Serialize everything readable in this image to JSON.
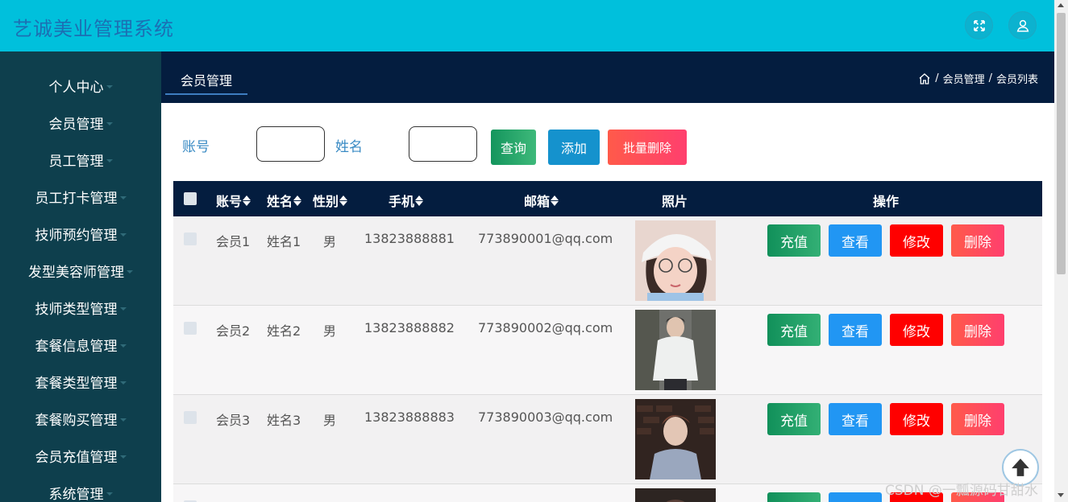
{
  "header": {
    "title": "艺诚美业管理系统"
  },
  "sidebar": {
    "items": [
      {
        "label": "个人中心"
      },
      {
        "label": "会员管理"
      },
      {
        "label": "员工管理"
      },
      {
        "label": "员工打卡管理"
      },
      {
        "label": "技师预约管理"
      },
      {
        "label": "发型美容师管理"
      },
      {
        "label": "技师类型管理"
      },
      {
        "label": "套餐信息管理"
      },
      {
        "label": "套餐类型管理"
      },
      {
        "label": "套餐购买管理"
      },
      {
        "label": "会员充值管理"
      },
      {
        "label": "系统管理"
      }
    ]
  },
  "subheader": {
    "active_tab": "会员管理",
    "breadcrumb": [
      "会员管理",
      "会员列表"
    ],
    "separator": "/"
  },
  "search": {
    "account_label": "账号",
    "name_label": "姓名",
    "query_label": "查询",
    "add_label": "添加",
    "batch_delete_label": "批量删除"
  },
  "table": {
    "headers": {
      "account": "账号",
      "name": "姓名",
      "gender": "性别",
      "phone": "手机",
      "email": "邮箱",
      "photo": "照片",
      "actions": "操作"
    },
    "rows": [
      {
        "account": "会员1",
        "name": "姓名1",
        "gender": "男",
        "phone": "13823888881",
        "email": "773890001@qq.com"
      },
      {
        "account": "会员2",
        "name": "姓名2",
        "gender": "男",
        "phone": "13823888882",
        "email": "773890002@qq.com"
      },
      {
        "account": "会员3",
        "name": "姓名3",
        "gender": "男",
        "phone": "13823888883",
        "email": "773890003@qq.com"
      }
    ],
    "action_labels": {
      "recharge": "充值",
      "view": "查看",
      "edit": "修改",
      "delete": "删除"
    }
  },
  "watermark": "CSDN @一瓢源码甘甜水",
  "colors": {
    "topbar": "#00c0dc",
    "sidebar": "#0e3f4d",
    "subbar": "#041d3f",
    "accent": "#3a8bc4"
  }
}
